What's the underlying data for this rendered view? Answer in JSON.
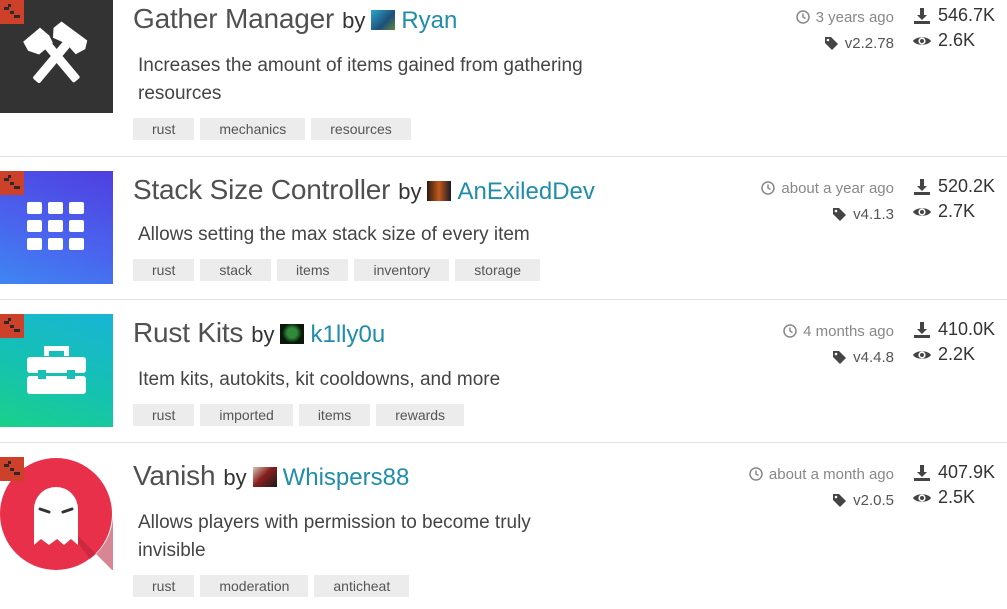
{
  "plugins": [
    {
      "title": "Gather Manager",
      "by": "by",
      "author": "Ryan",
      "description": "Increases the amount of items gained from gathering resources",
      "tags": [
        "rust",
        "mechanics",
        "resources"
      ],
      "updated": "3 years ago",
      "version": "v2.2.78",
      "downloads": "546.7K",
      "views": "2.6K",
      "thumb_color": "#333333"
    },
    {
      "title": "Stack Size Controller",
      "by": "by",
      "author": "AnExiledDev",
      "description": "Allows setting the max stack size of every item",
      "tags": [
        "rust",
        "stack",
        "items",
        "inventory",
        "storage"
      ],
      "updated": "about a year ago",
      "version": "v4.1.3",
      "downloads": "520.2K",
      "views": "2.7K",
      "thumb_color": "#4b4ee8"
    },
    {
      "title": "Rust Kits",
      "by": "by",
      "author": "k1lly0u",
      "description": "Item kits, autokits, kit cooldowns, and more",
      "tags": [
        "rust",
        "imported",
        "items",
        "rewards"
      ],
      "updated": "4 months ago",
      "version": "v4.4.8",
      "downloads": "410.0K",
      "views": "2.2K",
      "thumb_color": "#16b8c8"
    },
    {
      "title": "Vanish",
      "by": "by",
      "author": "Whispers88",
      "description": "Allows players with permission to become truly invisible",
      "tags": [
        "rust",
        "moderation",
        "anticheat"
      ],
      "updated": "about a month ago",
      "version": "v2.0.5",
      "downloads": "407.9K",
      "views": "2.5K",
      "thumb_color": "#e8304a"
    }
  ],
  "colors": {
    "author_link": "#1f8dab",
    "game_badge": "#cd412b",
    "tag_bg": "#ececec"
  }
}
